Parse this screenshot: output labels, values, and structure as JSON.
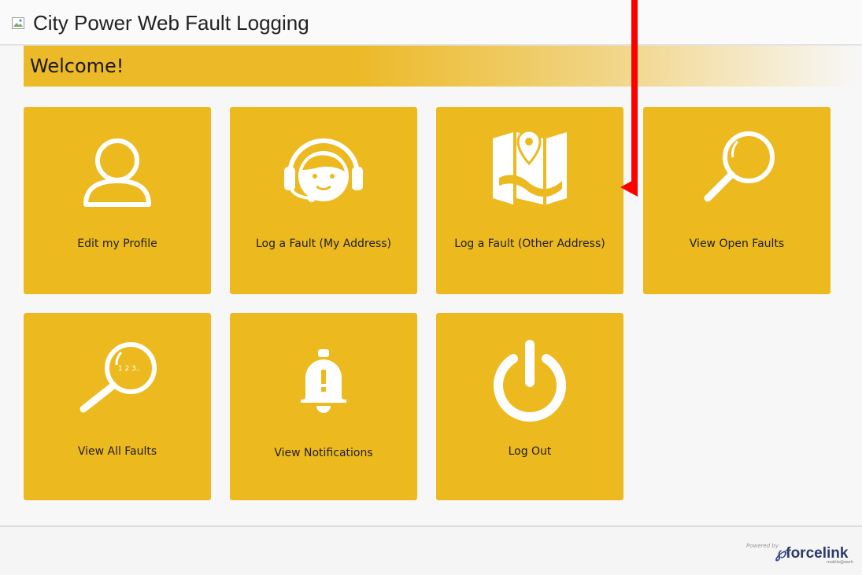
{
  "header": {
    "title": "City Power Web Fault Logging",
    "title_icon": "broken-image-icon"
  },
  "welcome": {
    "text": "Welcome!"
  },
  "tiles": [
    {
      "label": "Edit my Profile",
      "icon": "user-profile-icon"
    },
    {
      "label": "Log a Fault (My Address)",
      "icon": "headset-agent-icon"
    },
    {
      "label": "Log a Fault (Other Address)",
      "icon": "map-pin-icon"
    },
    {
      "label": "View Open Faults",
      "icon": "magnifier-icon"
    },
    {
      "label": "View All Faults",
      "icon": "magnifier-123-icon",
      "icon_text": "1 2 3.."
    },
    {
      "label": "View Notifications",
      "icon": "bell-alert-icon"
    },
    {
      "label": "Log Out",
      "icon": "power-icon"
    }
  ],
  "footer": {
    "powered_by": "Powered by",
    "brand": "forcelink",
    "brand_sub": "mobile@work"
  },
  "colors": {
    "tile": "#ecb91f",
    "arrow": "#ff0000",
    "brand": "#2b3a67"
  }
}
